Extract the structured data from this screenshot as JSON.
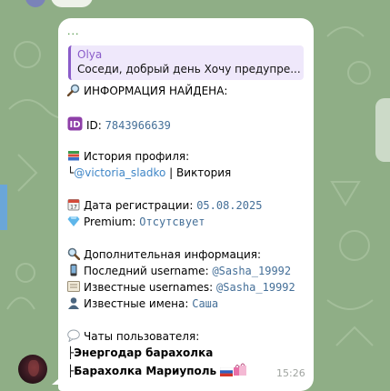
{
  "reply": {
    "author": "Olya",
    "preview": "Соседи, добрый день Хочу предупре..."
  },
  "message": {
    "header_dots": "...",
    "found_title": "ИНФОРМАЦИЯ НАЙДЕНА:",
    "id_label": "ID:",
    "id_value": "7843966639",
    "history_title": "История профиля:",
    "history_prefix": "└",
    "history_username": "@victoria_sladko",
    "history_sep": " | ",
    "history_name": "Виктория",
    "reg_label": "Дата регистрации:",
    "reg_value": "05.08.2025",
    "premium_label": "Premium:",
    "premium_value": "Отсутсвует",
    "extra_title": "Дополнительная информация:",
    "last_username_label": "Последний username:",
    "last_username_value": "@Sasha_19992",
    "known_usernames_label": "Известные usernames:",
    "known_usernames_value": "@Sasha_19992",
    "known_names_label": "Известные имена:",
    "known_names_value": "Саша",
    "chats_title": "Чаты пользователя:",
    "chat_1_prefix": "├",
    "chat_1": "Энергодар барахолка",
    "chat_2_prefix": "├",
    "chat_2": "Барахолка Мариуполь",
    "time": "15:26"
  },
  "icons": {
    "search": "magnifier-icon",
    "id": "id-icon",
    "books": "books-icon",
    "calendar": "calendar-icon",
    "diamond": "diamond-icon",
    "search_left": "magnifier-left-icon",
    "phone": "mobile-phone-icon",
    "card": "card-index-icon",
    "person": "bust-silhouette-icon",
    "speech": "speech-balloon-icon",
    "flag": "russia-flag-icon",
    "bags": "shopping-bags-icon"
  },
  "colors": {
    "background": "#8fae86",
    "bubble": "#ffffff",
    "reply_accent": "#8a5cc9",
    "link": "#3f86c7",
    "mono": "#446f98"
  }
}
